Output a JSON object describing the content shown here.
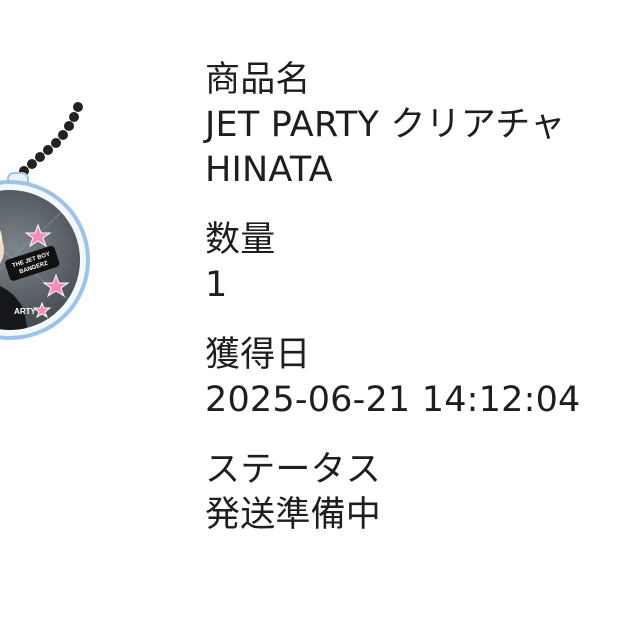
{
  "product": {
    "name_label": "商品名",
    "name_line1": "JET PARTY クリアチャ",
    "name_line2": "HINATA"
  },
  "quantity": {
    "label": "数量",
    "value": "1"
  },
  "acquired": {
    "label": "獲得日",
    "value": "2025-06-21 14:12:04"
  },
  "status": {
    "label": "ステータス",
    "value": "発送準備中"
  },
  "image": {
    "icon": "acrylic-keychain-image",
    "badge_text": "THE JET BOY BANGERZ",
    "footer_text": "ARTY"
  },
  "colors": {
    "background": "#ffffff",
    "text": "#1e1e1e",
    "chain": "#222222",
    "acrylic_ring": "#9dc4e8"
  }
}
